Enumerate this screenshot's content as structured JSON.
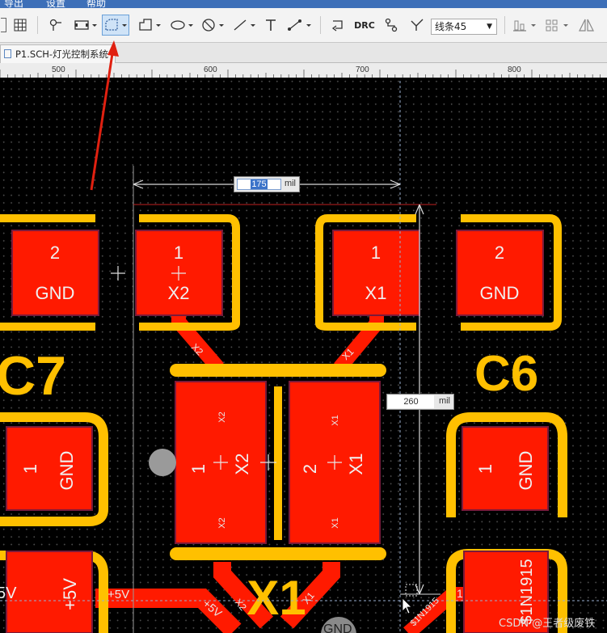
{
  "menu": {
    "items": [
      "导出",
      "设置",
      "帮助"
    ]
  },
  "toolbar": {
    "drc_label": "DRC",
    "line_style": "线条45"
  },
  "tab": {
    "title": "P1.SCH-灯光控制系统"
  },
  "ruler": {
    "labels": [
      "500",
      "600",
      "700",
      "800"
    ]
  },
  "dimension": {
    "width_value": "175",
    "height_value": "260",
    "unit": "mil"
  },
  "components": {
    "c7": {
      "designator": "C7",
      "pad_top_num": "2",
      "pad_top_net": "GND",
      "pad_bottom_num": "1",
      "pad_bottom_net": "GND"
    },
    "c6": {
      "designator": "C6",
      "pad_top_num": "2",
      "pad_top_net": "GND",
      "pad_bottom_num": "1",
      "pad_bottom_net": "GND"
    },
    "x1_small": {
      "pad1_num": "1",
      "pad1_net": "X2",
      "pad2_num": "1",
      "pad2_net": "X1"
    },
    "x1_big": {
      "designator": "X1",
      "pad1_num": "1",
      "pad1_net": "X2",
      "pad2_num": "2",
      "pad2_net": "X1",
      "pad1_small_top": "X2",
      "pad1_small_bottom": "X2",
      "pad2_small_top": "X1",
      "pad2_small_bottom": "X1"
    }
  },
  "traces": {
    "x2_label": "X2",
    "x1_label": "X1",
    "plus5v_left": "+5V",
    "plus5v_pad": "+5V",
    "plus5v_trace": "+5V",
    "plus5v_trace2": "+5V",
    "net_1n1915": "$1N1915",
    "net_1n1915_right": "$1N1915",
    "net_1n1915_trace": "1N1915",
    "gnd_bottom": "GND",
    "x2_bottom": "X2",
    "x1_bottom": "X1",
    "pad_5v_left": "5V"
  },
  "watermark": "CSDN @王者级废铁",
  "colors": {
    "pad": "#ff1a00",
    "silkscreen": "#ffc000",
    "board": "#000000",
    "pad_outline": "#7a1a3a",
    "trace": "#ff1a00"
  }
}
